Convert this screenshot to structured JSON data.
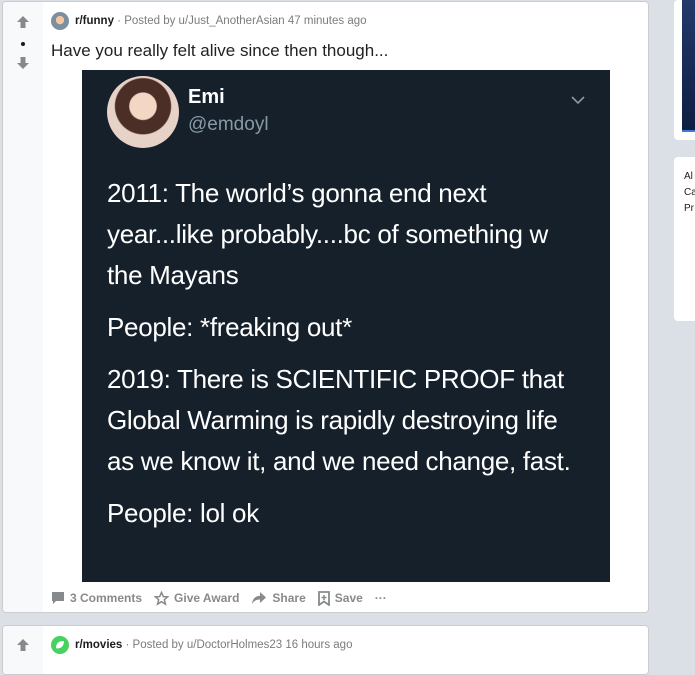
{
  "post1": {
    "subreddit": "r/funny",
    "posted_by": "· Posted by u/Just_AnotherAsian",
    "time": "47 minutes ago",
    "title": "Have you really felt alive since then though...",
    "tweet": {
      "display_name": "Emi",
      "handle": "@emdoyl",
      "paragraphs": [
        "2011: The world’s gonna end next year...like probably....bc of something w the Mayans",
        "People: *freaking out*",
        "2019: There is SCIENTIFIC PROOF that Global Warming is rapidly destroying life as we know it, and we need change, fast.",
        "People: lol ok"
      ]
    },
    "actions": {
      "comments": "3 Comments",
      "give_award": "Give Award",
      "share": "Share",
      "save": "Save",
      "more": "···"
    }
  },
  "post2": {
    "subreddit": "r/movies",
    "posted_by": "· Posted by u/DoctorHolmes23",
    "time": "16 hours ago"
  },
  "sidebar": {
    "truncated_lines": [
      "Al",
      "Ca",
      "Pr"
    ]
  },
  "colors": {
    "tweet_background": "#15202b",
    "movies_icon": "#46d160"
  }
}
